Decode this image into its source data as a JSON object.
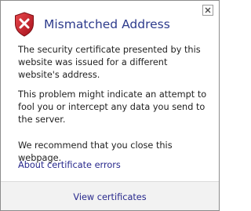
{
  "dialog": {
    "title": "Mismatched Address",
    "close_icon": "close-icon",
    "status_icon": "error-shield-icon",
    "paragraphs": [
      "The security certificate presented by this website was issued for a different website's address.",
      "This problem might indicate an attempt to fool you or intercept any data you send to the server.",
      "We recommend that you close this webpage."
    ],
    "about_link": "About certificate errors",
    "view_certificates": "View certificates"
  },
  "colors": {
    "title": "#2d3b8c",
    "link": "#27288c",
    "shield_red": "#c8202a",
    "footer_bg": "#f2f2f2"
  }
}
